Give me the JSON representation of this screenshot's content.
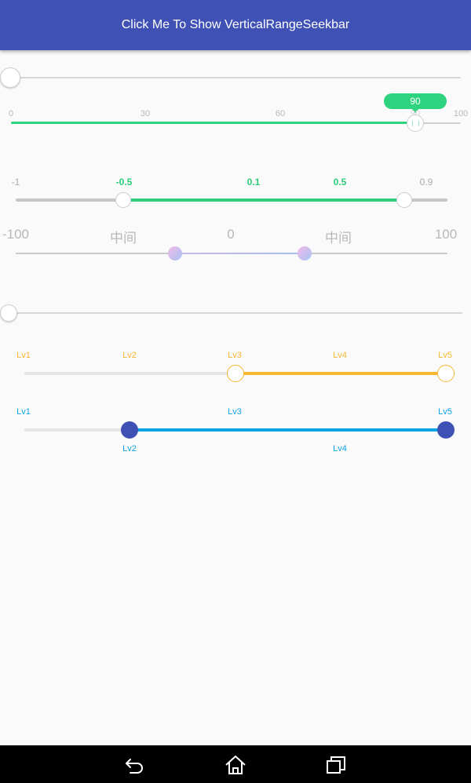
{
  "header": {
    "button_label": "Click Me To Show VerticalRangeSeekbar"
  },
  "seekbar1": {
    "value_fraction": 0.0
  },
  "seekbar2": {
    "ticks": [
      "0",
      "30",
      "60",
      "90",
      "100"
    ],
    "value": 90,
    "indicator": "90",
    "accent": "#2ed37f"
  },
  "seekbar3": {
    "ticks": [
      "-1",
      "-0.5",
      "0.1",
      "0.5",
      "0.9"
    ],
    "range_low": -0.5,
    "range_high": 0.9,
    "accent": "#2ecb7a"
  },
  "seekbar4": {
    "ticks": [
      "-100",
      "中间",
      "0",
      "中间",
      "100"
    ],
    "range_low": -40,
    "range_high": 20
  },
  "seekbar5": {
    "value_fraction": 0.0
  },
  "seekbar6": {
    "steps": [
      "Lv1",
      "Lv2",
      "Lv3",
      "Lv4",
      "Lv5"
    ],
    "range_low": "Lv3",
    "range_high": "Lv5",
    "accent": "#f7b731"
  },
  "seekbar7": {
    "top_labels": [
      "Lv1",
      "Lv3",
      "Lv5"
    ],
    "bottom_labels": [
      "Lv2",
      "Lv4"
    ],
    "range_low": "Lv2",
    "range_high": "Lv5",
    "accent": "#0aa3e3",
    "thumb_color": "#3f51b5"
  },
  "navbar": {
    "icons": [
      "back-icon",
      "home-icon",
      "recent-apps-icon"
    ]
  }
}
